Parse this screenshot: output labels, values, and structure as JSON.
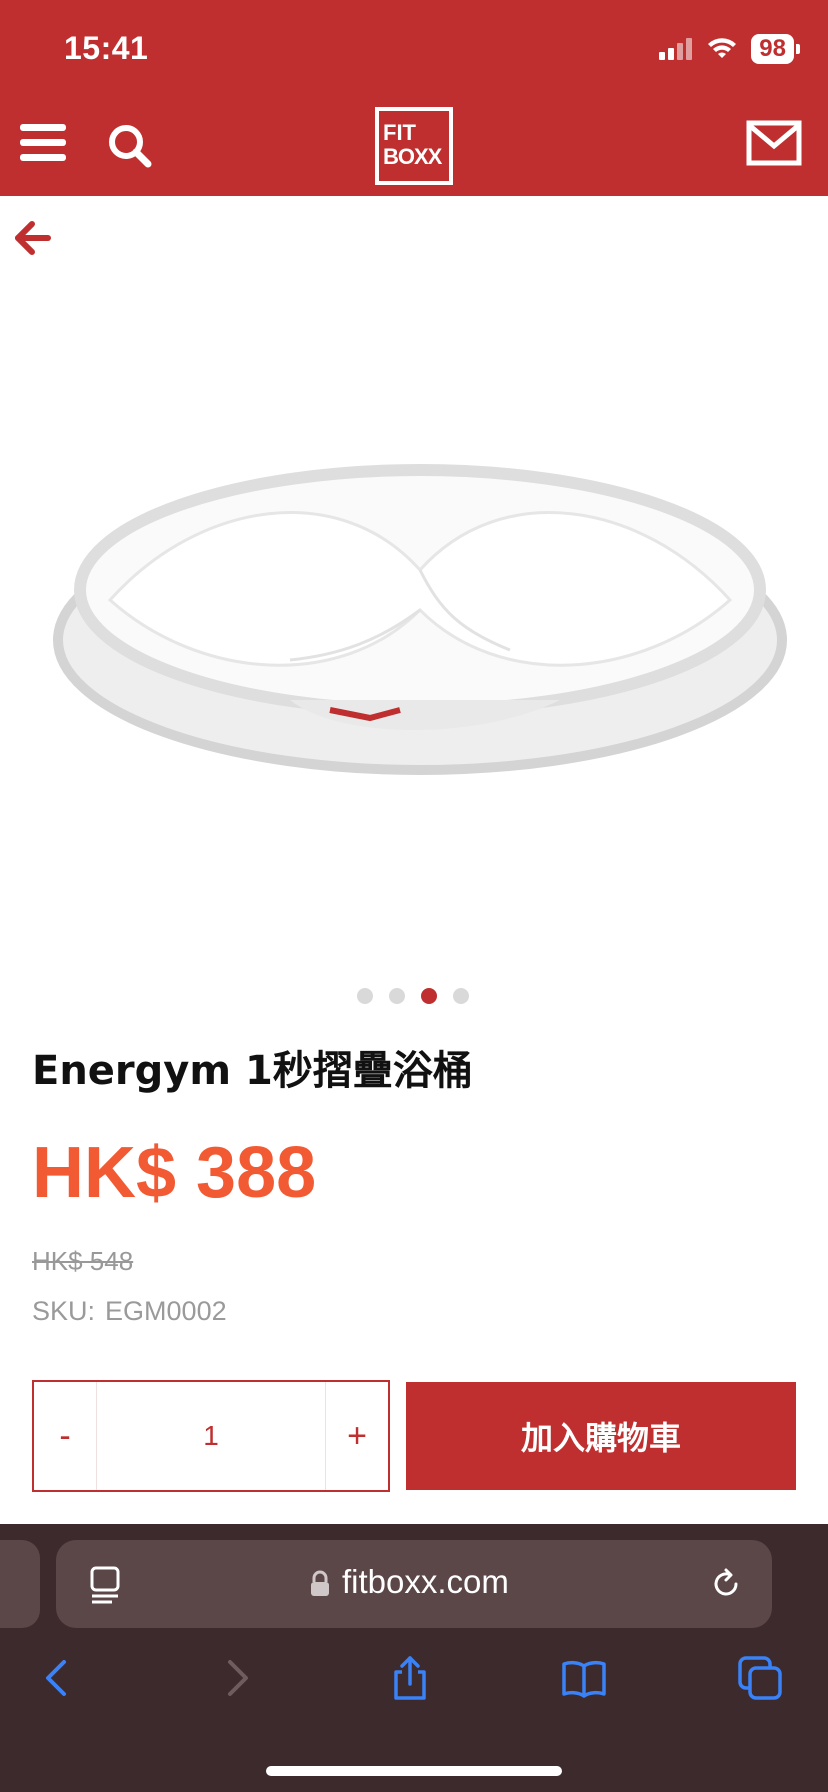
{
  "status_bar": {
    "time": "15:41",
    "battery": "98"
  },
  "header": {
    "logo_line1": "FIT",
    "logo_line2": "BOXX"
  },
  "carousel": {
    "total": 4,
    "active_index": 2
  },
  "product": {
    "title": "Energym 1秒摺疊浴桶",
    "price": "HK$ 388",
    "original_price": "HK$ 548",
    "sku_label": "SKU:",
    "sku_value": "EGM0002"
  },
  "purchase": {
    "minus_label": "-",
    "quantity": "1",
    "plus_label": "+",
    "add_to_cart_label": "加入購物車"
  },
  "browser": {
    "url": "fitboxx.com"
  },
  "colors": {
    "brand": "#bf2f2f",
    "price": "#f25a33",
    "browser_bar": "#3d2a2c",
    "toolbar_icon": "#3a82f7"
  }
}
